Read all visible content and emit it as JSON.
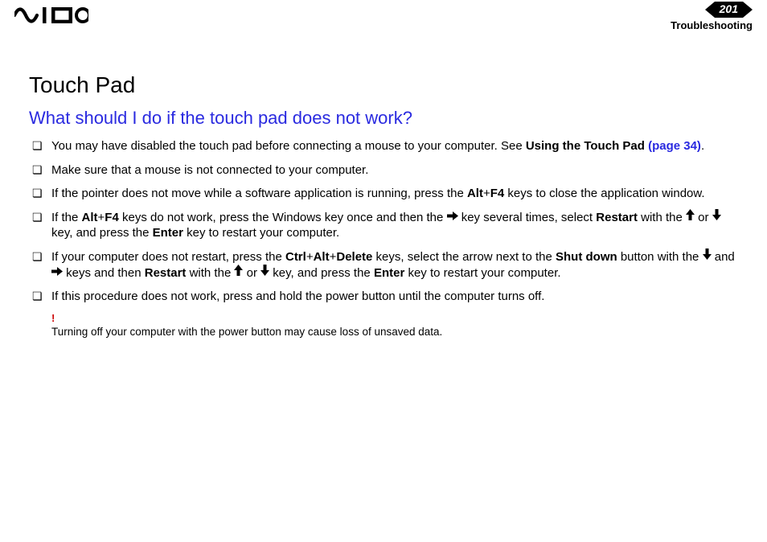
{
  "header": {
    "page_number": "201",
    "section": "Troubleshooting"
  },
  "title": "Touch Pad",
  "subtitle": "What should I do if the touch pad does not work?",
  "items": {
    "i0": {
      "t0": "You may have disabled the touch pad before connecting a mouse to your computer. See ",
      "b0": "Using the Touch Pad ",
      "link": "(page 34)",
      "t1": "."
    },
    "i1": "Make sure that a mouse is not connected to your computer.",
    "i2": {
      "t0": "If the pointer does not move while a software application is running, press the ",
      "b0": "Alt",
      "t1": "+",
      "b1": "F4",
      "t2": " keys to close the application window."
    },
    "i3": {
      "t0": "If the ",
      "b0": "Alt",
      "t1": "+",
      "b1": "F4",
      "t2": " keys do not work, press the Windows key once and then the ",
      "t3": " key several times, select ",
      "b2": "Restart",
      "t4": " with the ",
      "t5": " or ",
      "t6": " key, and press the ",
      "b3": "Enter",
      "t7": " key to restart your computer."
    },
    "i4": {
      "t0": "If your computer does not restart, press the ",
      "b0": "Ctrl",
      "t1": "+",
      "b1": "Alt",
      "t2": "+",
      "b2": "Delete",
      "t3": " keys, select the arrow next to the ",
      "b3": "Shut down",
      "t4": " button with the ",
      "t5": " and ",
      "t6": " keys and then ",
      "b4": "Restart",
      "t7": " with the ",
      "t8": " or ",
      "t9": " key, and press the ",
      "b5": "Enter",
      "t10": " key to restart your computer."
    },
    "i5": "If this procedure does not work, press and hold the power button until the computer turns off."
  },
  "note": {
    "bang": "!",
    "text": "Turning off your computer with the power button may cause loss of unsaved data."
  }
}
